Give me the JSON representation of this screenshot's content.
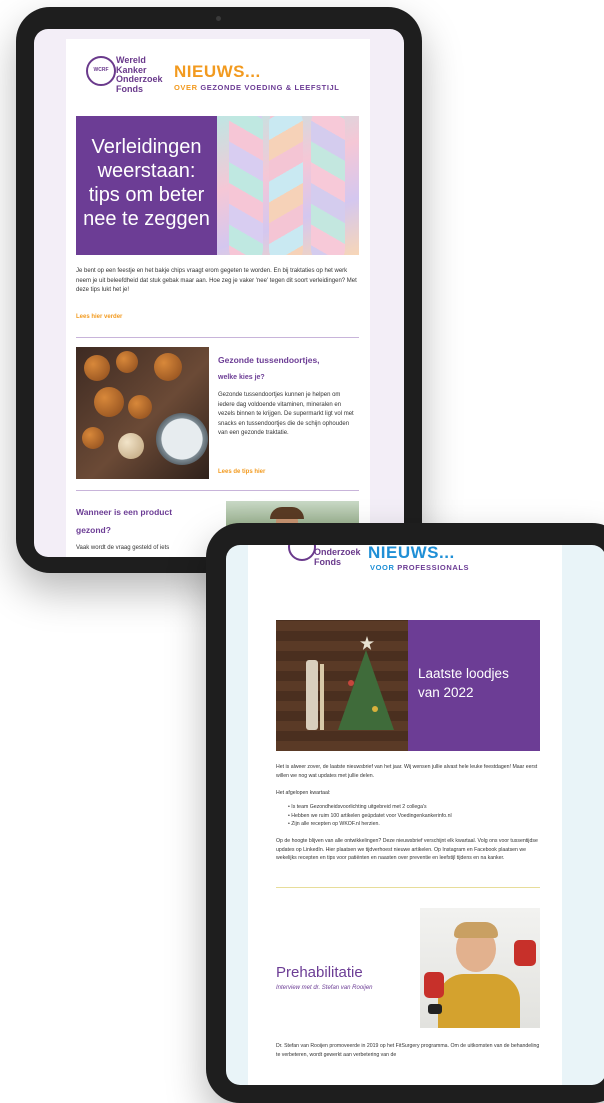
{
  "colors": {
    "brand_purple": "#6c3d95",
    "accent_orange": "#f29a1f",
    "accent_blue": "#1f8fd6"
  },
  "newsletter1": {
    "logo_lines": [
      "Wereld",
      "Kanker",
      "Onderzoek",
      "Fonds"
    ],
    "logo_mark": "WCRF",
    "nieuws": "NIEUWS...",
    "subtitle_prefix": "OVER",
    "subtitle_topic": "GEZONDE VOEDING & LEEFSTIJL",
    "hero": {
      "title_lines": [
        "Verleidingen",
        "weerstaan:",
        "tips om beter",
        "nee te zeggen"
      ],
      "image_icon": "marshmallow-twist-image"
    },
    "intro_text": "Je bent op een feestje en het bakje chips vraagt erom gegeten te worden. En bij traktaties op het werk neem je uit beleefdheid dat stuk gebak maar aan. Hoe zeg je vaker 'nee' tegen dit soort verleidingen? Met deze tips lukt het je!",
    "read_more": "Lees hier verder",
    "article2": {
      "title_lines": [
        "Gezonde tussendoortjes,",
        "welke kies je?"
      ],
      "text": "Gezonde tussendoortjes kunnen je helpen om iedere dag voldoende vitaminen, mineralen en vezels binnen te krijgen. De supermarkt ligt vol met snacks en tussendoortjes die de schijn ophouden van een gezonde traktatie.",
      "link": "Lees de tips hier",
      "image_icon": "snack-bites-image"
    },
    "article3": {
      "title_lines": [
        "Wanneer is een product",
        "gezond?"
      ],
      "text": "Vaak wordt de vraag gesteld of iets",
      "image_icon": "man-with-vegetables-image"
    }
  },
  "newsletter2": {
    "logo_lines": [
      "Onderzoek",
      "Fonds"
    ],
    "nieuws": "NIEUWS...",
    "subtitle_prefix": "VOOR",
    "subtitle_topic": "PROFESSIONALS",
    "hero": {
      "title_lines": [
        "Laatste loodjes",
        "van 2022"
      ],
      "image_icon": "christmas-tree-image"
    },
    "intro_text": "Het is alweer zover, de laatste nieuwsbrief van het jaar. Wij wensen jullie alvast hele leuke feestdagen! Maar eerst willen we nog wat updates met jullie delen.",
    "list_heading": "Het afgelopen kwartaal:",
    "bullets": [
      "Is team Gezondheidsvoorlichting uitgebreid met 2 collega's",
      "Hebben we ruim 100 artikelen geüpdatet voor Voedingenkankerinfo.nl",
      "Zijn alle recepten op WKOF.nl herzien."
    ],
    "followup_text": "Op de hoogte blijven van alle ontwikkelingen? Deze nieuwsbrief verschijnt elk kwartaal. Volg ons voor tussentijdse updates op LinkedIn. Hier plaatsen we tijdverhoest nieuwe artikelen. Op Instagram en Facebook plaatsen we wekelijks recepten en tips voor patiënten en naasten over preventie en leefstijl tijdens en na kanker.",
    "linkedin": "LinkedIn",
    "instagram": "Instagram",
    "facebook": "Facebook",
    "article2": {
      "title": "Prehabilitatie",
      "subtitle": "Interview met dr. Stefan van Rooijen",
      "image_icon": "man-with-dumbbells-image"
    },
    "bottom_text": "Dr. Stefan van Rooijen promoveerde in 2019 op het FitSurgery programma. Om de uitkomsten van de behandeling te verbeteren, wordt gewerkt aan verbetering van de"
  }
}
